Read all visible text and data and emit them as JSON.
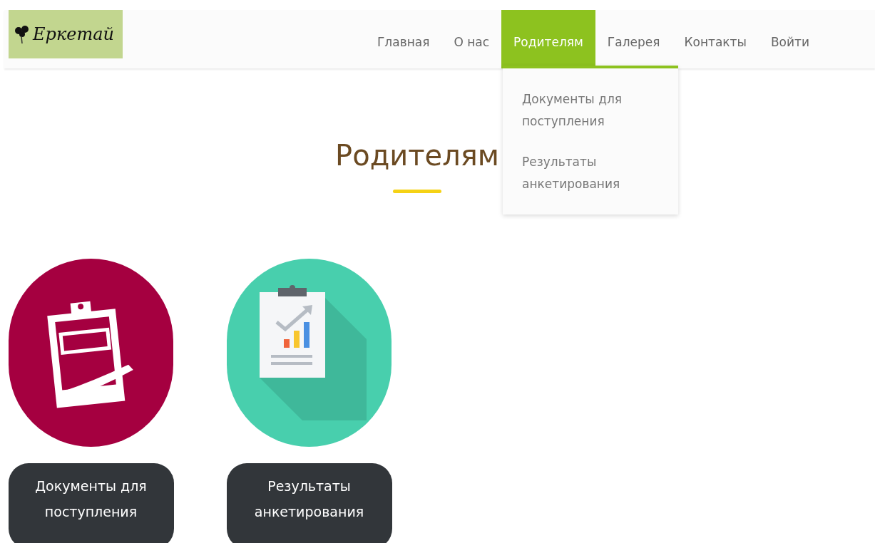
{
  "logo": {
    "text": "Еркетай"
  },
  "nav": [
    {
      "label": "Главная",
      "selected": false
    },
    {
      "label": "О нас",
      "selected": false
    },
    {
      "label": "Родителям",
      "selected": true
    },
    {
      "label": "Галерея",
      "selected": false
    },
    {
      "label": "Контакты",
      "selected": false
    },
    {
      "label": "Войти",
      "selected": false
    }
  ],
  "dropdown": {
    "items": [
      "Документы для поступления",
      "Результаты анкетирования"
    ]
  },
  "heading": "Родителям",
  "cards": [
    {
      "kind": "documents",
      "color": "#a50040",
      "label": "Документы для поступления"
    },
    {
      "kind": "survey",
      "color": "#48cfad",
      "label": "Результаты анкетирования"
    }
  ]
}
